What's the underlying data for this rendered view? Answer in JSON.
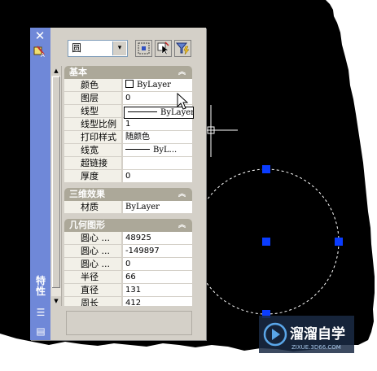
{
  "panel": {
    "close_glyph": "✕",
    "vertical_title": "特性",
    "object_select": {
      "value": "圆",
      "arrow": "▾"
    },
    "toolbar_icons": [
      "pickadd-icon",
      "select-objects-icon",
      "quick-select-icon"
    ]
  },
  "scrollbar": {
    "up": "▲",
    "down": "▼"
  },
  "sections": [
    {
      "title": "基本",
      "chevron": "︽",
      "rows": [
        {
          "label": "颜色",
          "value": "ByLayer"
        },
        {
          "label": "图层",
          "value": "0"
        },
        {
          "label": "线型",
          "value": ""
        },
        {
          "label": "线型比例",
          "value": "1"
        },
        {
          "label": "打印样式",
          "value": "随颜色"
        },
        {
          "label": "线宽",
          "value": "ByL..."
        },
        {
          "label": "超链接",
          "value": ""
        },
        {
          "label": "厚度",
          "value": "0"
        }
      ]
    },
    {
      "title": "三维效果",
      "chevron": "︽",
      "rows": [
        {
          "label": "材质",
          "value": "ByLayer"
        }
      ]
    },
    {
      "title": "几何图形",
      "chevron": "︽",
      "rows": [
        {
          "label": "圆心 ...",
          "value": "48925"
        },
        {
          "label": "圆心 ...",
          "value": "-149897"
        },
        {
          "label": "圆心 ...",
          "value": "0"
        },
        {
          "label": "半径",
          "value": "66"
        },
        {
          "label": "直径",
          "value": "131"
        },
        {
          "label": "周长",
          "value": "412"
        }
      ]
    }
  ],
  "linetype_dropdown": {
    "value": "ByLayer"
  },
  "watermark": {
    "brand": "溜溜自学",
    "url": "ZIXUE.3D66.COM"
  },
  "colors": {
    "canvas": "#000000",
    "titlebar": "#6f88d8",
    "grip": "#0a3cff",
    "section_header": "#aca899"
  }
}
